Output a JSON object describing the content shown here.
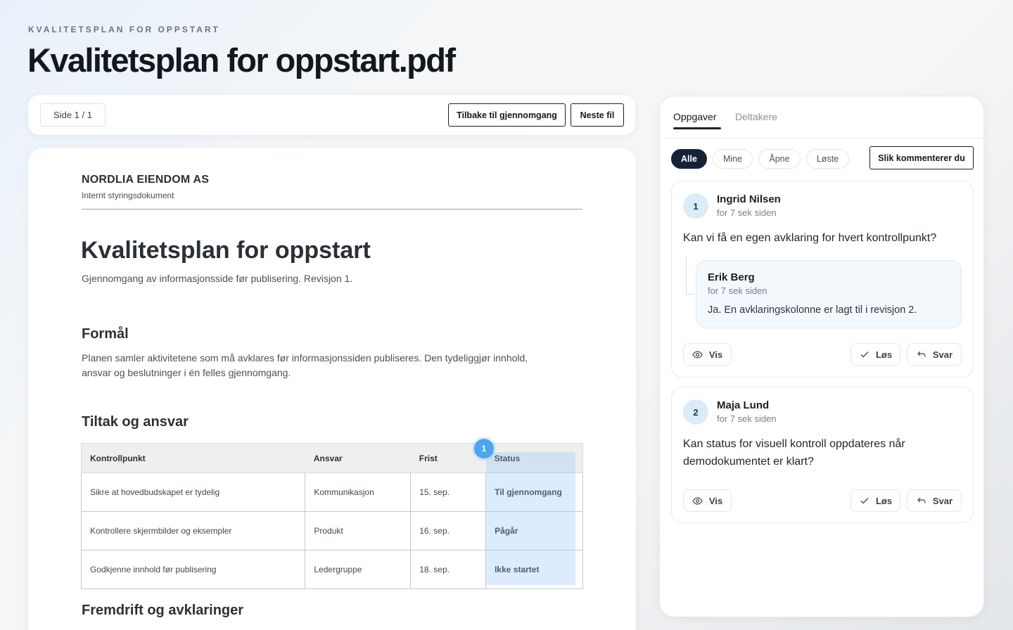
{
  "header": {
    "eyebrow": "KVALITETSPLAN FOR OPPSTART",
    "title": "Kvalitetsplan for oppstart.pdf"
  },
  "toolbar": {
    "page_indicator": "Side 1 / 1",
    "back_label": "Tilbake til gjennomgang",
    "next_label": "Neste fil"
  },
  "document": {
    "company": "NORDLIA EIENDOM AS",
    "subtitle": "Internt styringsdokument",
    "title": "Kvalitetsplan for oppstart",
    "intro": "Gjennomgang av informasjonsside før publisering. Revisjon 1.",
    "section_purpose": "Formål",
    "purpose_text": "Planen samler aktivitetene som må avklares før informasjonssiden publiseres. Den tydeliggjør innhold, ansvar og beslutninger i én felles gjennomgang.",
    "section_actions": "Tiltak og ansvar",
    "section_progress": "Fremdrift og avklaringer",
    "table": {
      "headers": [
        "Kontrollpunkt",
        "Ansvar",
        "Frist",
        "Status"
      ],
      "rows": [
        [
          "Sikre at hovedbudskapet er tydelig",
          "Kommunikasjon",
          "15. sep.",
          "Til gjennomgang"
        ],
        [
          "Kontrollere skjermbilder og eksempler",
          "Produkt",
          "16. sep.",
          "Pågår"
        ],
        [
          "Godkjenne innhold før publisering",
          "Ledergruppe",
          "18. sep.",
          "Ikke startet"
        ]
      ]
    },
    "pin_number": "1",
    "highlight_color": "#91c4f5"
  },
  "panel": {
    "tabs": [
      "Oppgaver",
      "Deltakere"
    ],
    "active_tab": "Oppgaver",
    "filters": [
      "Alle",
      "Mine",
      "Åpne",
      "Løste"
    ],
    "active_filter": "Alle",
    "howto_label": "Slik kommenterer du",
    "comments": [
      {
        "number": "1",
        "author": "Ingrid Nilsen",
        "time": "for 7 sek siden",
        "text": "Kan vi få en egen avklaring for hvert kontrollpunkt?",
        "reply": {
          "author": "Erik Berg",
          "time": "for 7 sek siden",
          "text": "Ja. En avklaringskolonne er lagt til i revisjon 2."
        },
        "actions": {
          "view": "Vis",
          "resolve": "Løs",
          "reply": "Svar"
        }
      },
      {
        "number": "2",
        "author": "Maja Lund",
        "time": "for 7 sek siden",
        "text": "Kan status for visuell kontroll oppdateres når demodokumentet er klart?",
        "actions": {
          "view": "Vis",
          "resolve": "Løs",
          "reply": "Svar"
        }
      }
    ]
  },
  "icons": {
    "view": "eye-icon",
    "resolve": "check-icon",
    "reply": "reply-arrow-icon"
  },
  "colors": {
    "accent_dark": "#15233a",
    "pin_blue": "#4aa5ee",
    "avatar_bg": "#d9ecf8"
  }
}
